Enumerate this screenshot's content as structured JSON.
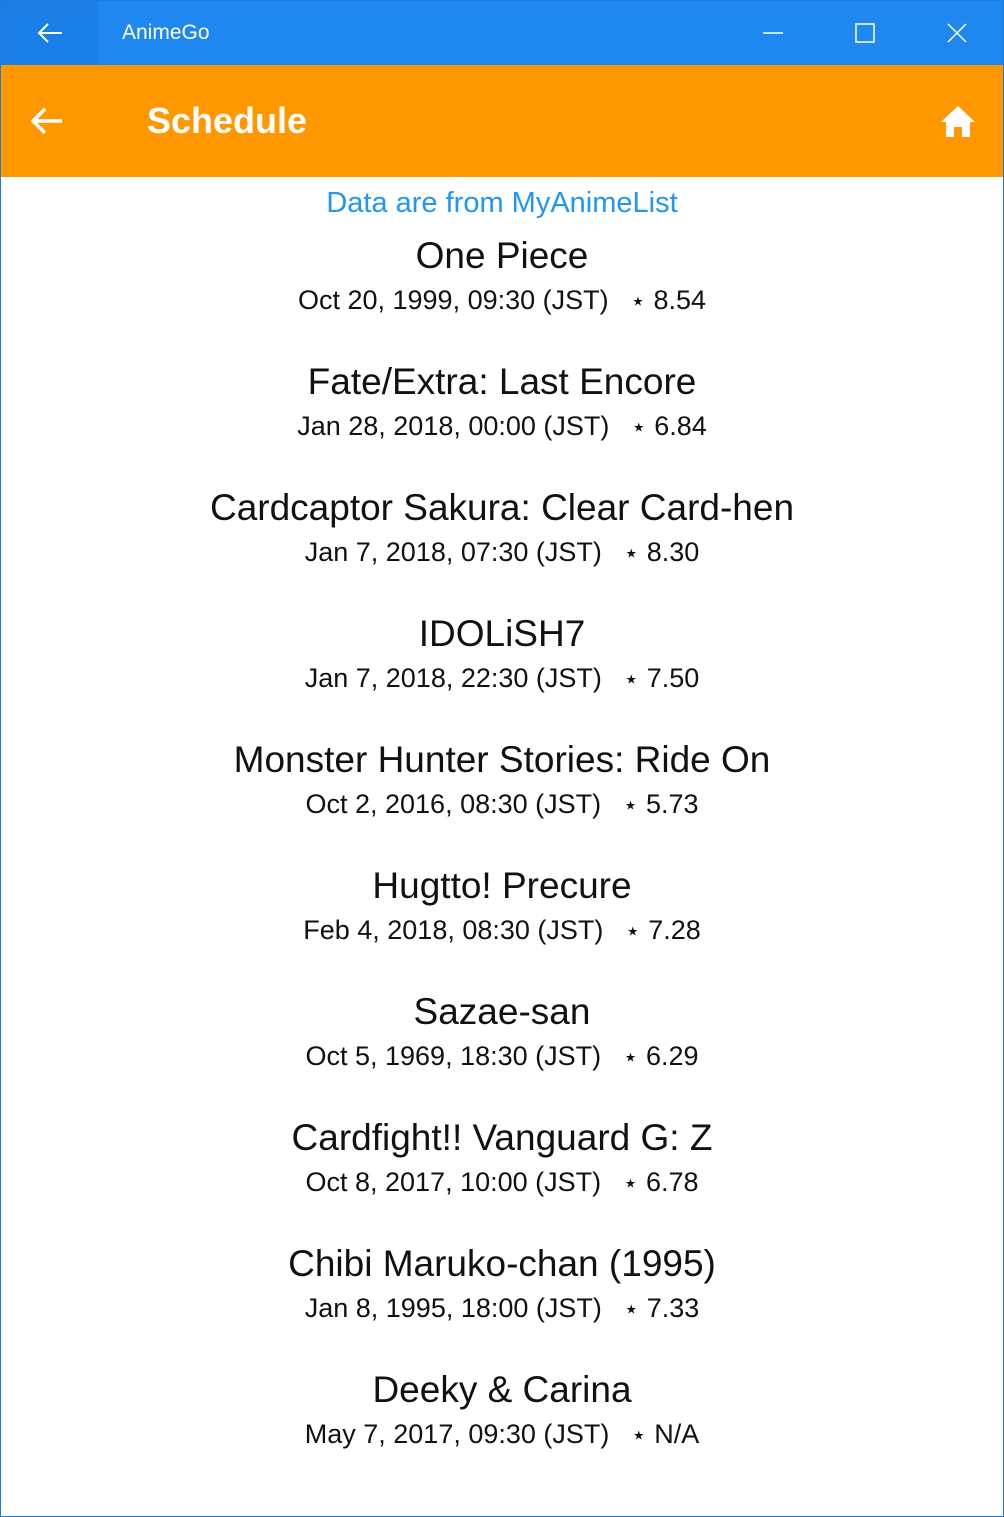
{
  "window": {
    "title": "AnimeGo"
  },
  "appbar": {
    "title": "Schedule"
  },
  "source_text": "Data are from MyAnimeList",
  "star_glyph": "⭑",
  "items": [
    {
      "title": "One Piece",
      "date": "Oct 20, 1999, 09:30 (JST)",
      "score": "8.54"
    },
    {
      "title": "Fate/Extra: Last Encore",
      "date": "Jan 28, 2018, 00:00 (JST)",
      "score": "6.84"
    },
    {
      "title": "Cardcaptor Sakura: Clear Card-hen",
      "date": "Jan 7, 2018, 07:30 (JST)",
      "score": "8.30"
    },
    {
      "title": "IDOLiSH7",
      "date": "Jan 7, 2018, 22:30 (JST)",
      "score": "7.50"
    },
    {
      "title": "Monster Hunter Stories: Ride On",
      "date": "Oct 2, 2016, 08:30 (JST)",
      "score": "5.73"
    },
    {
      "title": "Hugtto! Precure",
      "date": "Feb 4, 2018, 08:30 (JST)",
      "score": "7.28"
    },
    {
      "title": "Sazae-san",
      "date": "Oct 5, 1969, 18:30 (JST)",
      "score": "6.29"
    },
    {
      "title": "Cardfight!! Vanguard G: Z",
      "date": "Oct 8, 2017, 10:00 (JST)",
      "score": "6.78"
    },
    {
      "title": "Chibi Maruko-chan (1995)",
      "date": "Jan 8, 1995, 18:00 (JST)",
      "score": "7.33"
    },
    {
      "title": "Deeky & Carina",
      "date": "May 7, 2017, 09:30 (JST)",
      "score": "N/A"
    }
  ]
}
